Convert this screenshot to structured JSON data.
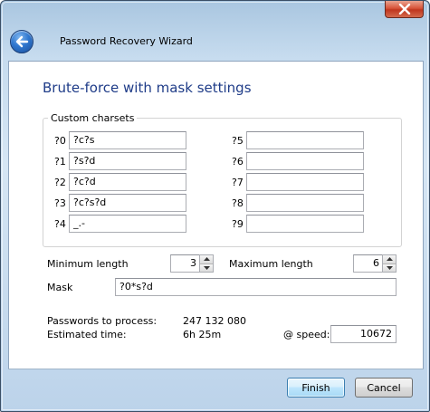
{
  "window": {
    "title": "Password Recovery Wizard"
  },
  "heading": "Brute-force with mask settings",
  "charsets": {
    "legend": "Custom charsets",
    "left": [
      {
        "label": "?0",
        "value": "?c?s"
      },
      {
        "label": "?1",
        "value": "?s?d"
      },
      {
        "label": "?2",
        "value": "?c?d"
      },
      {
        "label": "?3",
        "value": "?c?s?d"
      },
      {
        "label": "?4",
        "value": "_.-"
      }
    ],
    "right": [
      {
        "label": "?5",
        "value": ""
      },
      {
        "label": "?6",
        "value": ""
      },
      {
        "label": "?7",
        "value": ""
      },
      {
        "label": "?8",
        "value": ""
      },
      {
        "label": "?9",
        "value": ""
      }
    ]
  },
  "length": {
    "min_label": "Minimum length",
    "min_value": "3",
    "max_label": "Maximum length",
    "max_value": "6"
  },
  "mask": {
    "label": "Mask",
    "value": "?0*s?d"
  },
  "stats": {
    "passwords_label": "Passwords to process:",
    "passwords_value": "247 132 080",
    "time_label": "Estimated time:",
    "time_value": "6h 25m",
    "speed_label": "@ speed:",
    "speed_value": "10672"
  },
  "buttons": {
    "finish": "Finish",
    "cancel": "Cancel"
  },
  "icons": {
    "close": "close-icon",
    "back": "back-arrow-icon",
    "spin_up": "spin-up-icon",
    "spin_down": "spin-down-icon"
  },
  "colors": {
    "heading": "#1f3c88",
    "close_button": "#c0361e",
    "default_button_border": "#3c7fb1"
  }
}
